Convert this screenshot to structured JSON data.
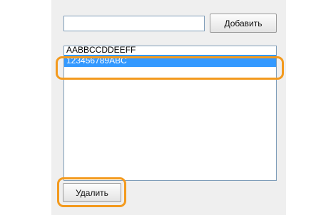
{
  "form": {
    "text_value": "",
    "add_label": "Добавить",
    "delete_label": "Удалить"
  },
  "list": {
    "items": [
      {
        "label": "AABBCCDDEEFF",
        "selected": false
      },
      {
        "label": "123456789ABC",
        "selected": true
      }
    ]
  },
  "colors": {
    "selection": "#3399ff",
    "callout": "#f39a1e",
    "panel_background": "#efefef"
  }
}
